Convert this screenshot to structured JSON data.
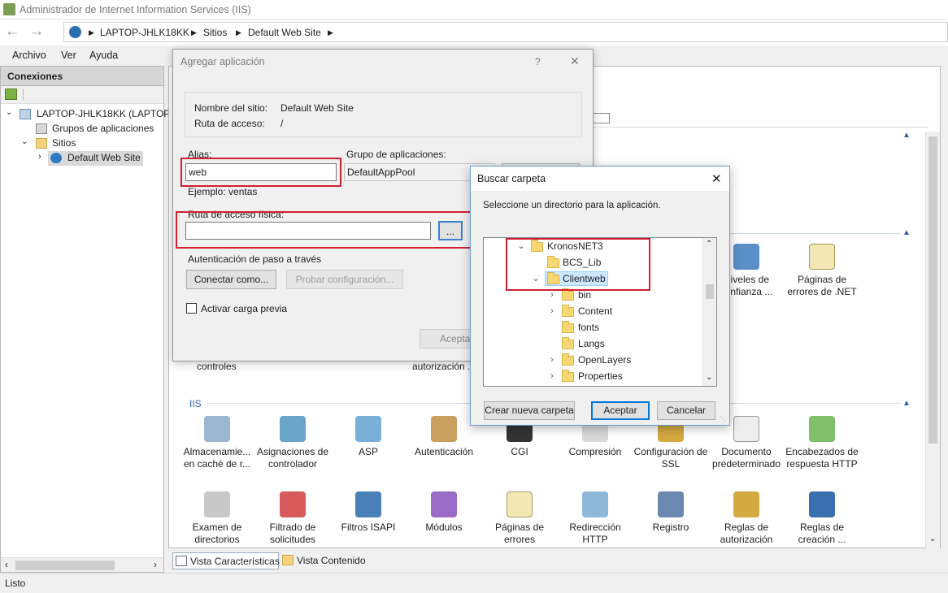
{
  "window": {
    "title": "Administrador de Internet Information Services (IIS)"
  },
  "address": {
    "crumbs": [
      "LAPTOP-JHLK18KK",
      "Sitios",
      "Default Web Site"
    ]
  },
  "menu": [
    "Archivo",
    "Ver",
    "Ayuda"
  ],
  "connections": {
    "header": "Conexiones",
    "tree": [
      "LAPTOP-JHLK18KK (LAPTOP-",
      "Grupos de aplicaciones",
      "Sitios",
      "Default Web Site"
    ]
  },
  "main": {
    "behind_labels": [
      "controles",
      "autorización ..."
    ],
    "group_iis": "IIS",
    "row_top": [
      {
        "label": "Niveles de confianza ...",
        "icon": "trust-levels-icon"
      },
      {
        "label": "Páginas de errores de .NET",
        "icon": "net-error-pages-icon"
      }
    ],
    "row1": [
      {
        "label": "Almacenamie... en caché de r...",
        "icon": "output-cache-icon"
      },
      {
        "label": "Asignaciones de controlador",
        "icon": "handler-mappings-icon"
      },
      {
        "label": "ASP",
        "icon": "asp-icon"
      },
      {
        "label": "Autenticación",
        "icon": "authentication-icon"
      },
      {
        "label": "CGI",
        "icon": "cgi-icon"
      },
      {
        "label": "Compresión",
        "icon": "compression-icon"
      },
      {
        "label": "Configuración de SSL",
        "icon": "ssl-settings-icon"
      },
      {
        "label": "Documento predeterminado",
        "icon": "default-document-icon"
      },
      {
        "label": "Encabezados de respuesta HTTP",
        "icon": "http-headers-icon"
      }
    ],
    "row2": [
      {
        "label": "Examen de directorios",
        "icon": "directory-browsing-icon"
      },
      {
        "label": "Filtrado de solicitudes",
        "icon": "request-filtering-icon"
      },
      {
        "label": "Filtros ISAPI",
        "icon": "isapi-filters-icon"
      },
      {
        "label": "Módulos",
        "icon": "modules-icon"
      },
      {
        "label": "Páginas de errores",
        "icon": "error-pages-icon"
      },
      {
        "label": "Redirección HTTP",
        "icon": "http-redirect-icon"
      },
      {
        "label": "Registro",
        "icon": "logging-icon"
      },
      {
        "label": "Reglas de autorización",
        "icon": "authorization-rules-icon"
      },
      {
        "label": "Reglas de creación ...",
        "icon": "authoring-rules-icon"
      }
    ]
  },
  "bottom_tabs": [
    "Vista Características",
    "Vista Contenido"
  ],
  "status": "Listo",
  "add_app_dialog": {
    "title": "Agregar aplicación",
    "help": "?",
    "close": "✕",
    "site_name_label": "Nombre del sitio:",
    "site_name_value": "Default Web Site",
    "path_label": "Ruta de acceso:",
    "path_value": "/",
    "alias_label": "Alias:",
    "alias_value": "web",
    "pool_label": "Grupo de aplicaciones:",
    "pool_value": "DefaultAppPool",
    "example": "Ejemplo: ventas",
    "phys_path_label": "Ruta de acceso física:",
    "phys_path_value": "",
    "browse": "...",
    "passthrough_label": "Autenticación de paso a través",
    "connect_as": "Conectar como...",
    "test_settings": "Probar configuración...",
    "preload_label": "Activar carga previa",
    "ok_partial": "Acepta"
  },
  "folder_dialog": {
    "title": "Buscar carpeta",
    "close": "✕",
    "instruction": "Seleccione un directorio para la aplicación.",
    "tree": [
      {
        "label": "KronosNET3",
        "expanded": true,
        "level": 0
      },
      {
        "label": "BCS_Lib",
        "level": 1
      },
      {
        "label": "Clientweb",
        "expanded": true,
        "selected": true,
        "level": 1
      },
      {
        "label": "bin",
        "level": 2,
        "has_children": true
      },
      {
        "label": "Content",
        "level": 2,
        "has_children": true
      },
      {
        "label": "fonts",
        "level": 2
      },
      {
        "label": "Langs",
        "level": 2
      },
      {
        "label": "OpenLayers",
        "level": 2,
        "has_children": true
      },
      {
        "label": "Properties",
        "level": 2,
        "has_children": true
      }
    ],
    "new_folder": "Crear nueva carpeta",
    "ok": "Aceptar",
    "cancel": "Cancelar"
  },
  "colors": {
    "highlight_red": "#d02030",
    "selection": "#cce8ff",
    "accent": "#0078d7"
  }
}
